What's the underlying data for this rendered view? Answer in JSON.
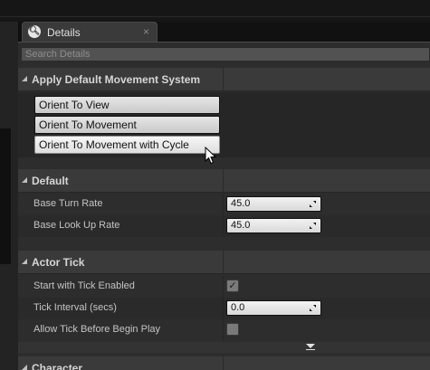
{
  "tab": {
    "title": "Details",
    "icon": "details-magnifier-icon",
    "close": "×"
  },
  "search": {
    "placeholder": "Search Details"
  },
  "sections": {
    "apply_default_movement": {
      "title": "Apply Default Movement System",
      "buttons": [
        "Orient To View",
        "Orient To Movement",
        "Orient To Movement with Cycle"
      ]
    },
    "default": {
      "title": "Default",
      "base_turn_rate_label": "Base Turn Rate",
      "base_turn_rate_value": "45.0",
      "base_look_up_rate_label": "Base Look Up Rate",
      "base_look_up_rate_value": "45.0"
    },
    "actor_tick": {
      "title": "Actor Tick",
      "start_with_tick_label": "Start with Tick Enabled",
      "start_with_tick_checked": true,
      "tick_interval_label": "Tick Interval (secs)",
      "tick_interval_value": "0.0",
      "allow_tick_before_label": "Allow Tick Before Begin Play",
      "allow_tick_before_checked": false
    },
    "character": {
      "title": "Character"
    }
  },
  "check_glyph": "✓",
  "colors": {
    "panel": "#2d2d2d",
    "category": "#3a3a3a",
    "button": "#dcdcdc"
  }
}
